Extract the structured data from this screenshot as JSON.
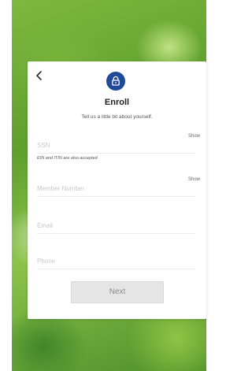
{
  "enroll": {
    "title": "Enroll",
    "subtitle": "Tell us a little bit about yourself.",
    "back_icon": "chevron-left-icon",
    "lock_icon": "lock-icon",
    "accent_color": "#1f4a9a"
  },
  "fields": {
    "ssn": {
      "placeholder": "SSN",
      "show_label": "Show",
      "hint": "EIN and ITIN are also accepted"
    },
    "member_number": {
      "placeholder": "Member Number",
      "show_label": "Show"
    },
    "email": {
      "placeholder": "Email"
    },
    "phone": {
      "placeholder": "Phone"
    }
  },
  "actions": {
    "next_label": "Next"
  }
}
